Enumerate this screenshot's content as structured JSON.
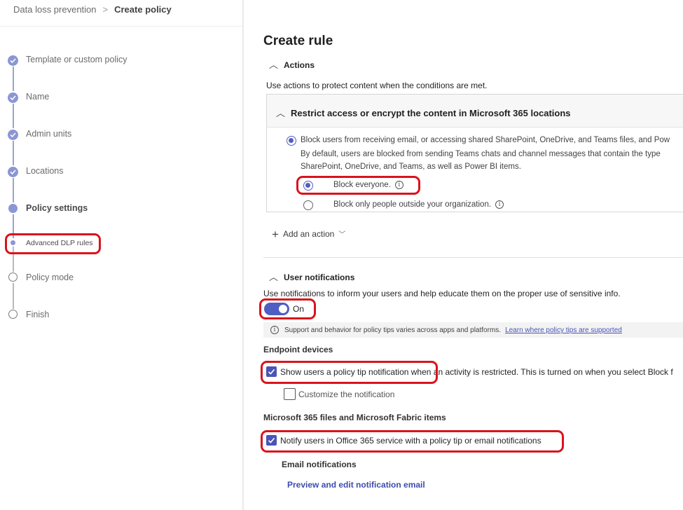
{
  "breadcrumb": {
    "parent": "Data loss prevention",
    "separator": ">",
    "current": "Create policy"
  },
  "steps": [
    {
      "label": "Template or custom policy",
      "state": "done"
    },
    {
      "label": "Name",
      "state": "done"
    },
    {
      "label": "Admin units",
      "state": "done"
    },
    {
      "label": "Locations",
      "state": "done"
    },
    {
      "label": "Policy settings",
      "state": "active"
    },
    {
      "label": "Advanced DLP rules",
      "state": "sub-active"
    },
    {
      "label": "Policy mode",
      "state": "pending"
    },
    {
      "label": "Finish",
      "state": "pending"
    }
  ],
  "main": {
    "title": "Create rule",
    "actions": {
      "header": "Actions",
      "description": "Use actions to protect content when the conditions are met.",
      "panel_title": "Restrict access or encrypt the content in Microsoft 365 locations",
      "block_option": "Block users from receiving email, or accessing shared SharePoint, OneDrive, and Teams files, and Pow",
      "block_desc_line1": "By default, users are blocked from sending Teams chats and channel messages that contain the type",
      "block_desc_line2": "SharePoint, OneDrive, and Teams, as well as Power BI items.",
      "block_everyone": "Block everyone.",
      "block_outside": "Block only people outside your organization.",
      "add_action": "Add an action"
    },
    "notifications": {
      "header": "User notifications",
      "description": "Use notifications to inform your users and help educate them on the proper use of sensitive info.",
      "toggle_label": "On",
      "toggle_state": "on",
      "info_text": "Support and behavior for policy tips varies across apps and platforms.",
      "info_link": "Learn where policy tips are supported",
      "endpoint_header": "Endpoint devices",
      "endpoint_checkbox": "Show users a policy tip notification when an activity is restricted. This is turned on when you select Block f",
      "customize": "Customize the notification",
      "m365_header": "Microsoft 365 files and Microsoft Fabric items",
      "notify_checkbox": "Notify users in Office 365 service with a policy tip or email notifications",
      "email_header": "Email notifications",
      "preview_link": "Preview and edit notification email"
    }
  },
  "colors": {
    "accent": "#4f5ec2",
    "highlight": "#d8141c",
    "step": "#8b96d4"
  },
  "icons": [
    "check-icon",
    "chevron-up-icon",
    "info-icon",
    "plus-icon",
    "chevron-down-icon"
  ]
}
